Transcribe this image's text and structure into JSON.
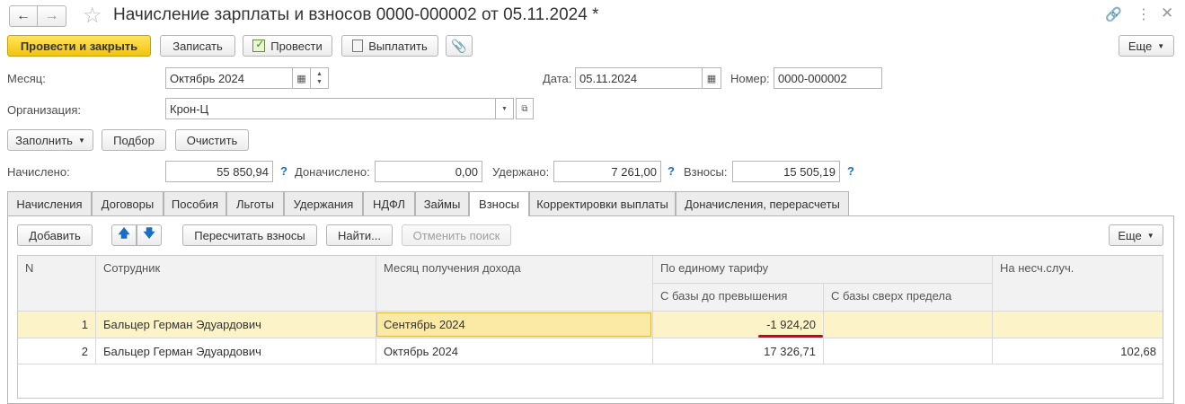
{
  "window": {
    "title": "Начисление зарплаты и взносов 0000-000002 от 05.11.2024 *"
  },
  "toolbar": {
    "post_and_close": "Провести и закрыть",
    "save": "Записать",
    "post": "Провести",
    "pay": "Выплатить",
    "more": "Еще"
  },
  "form": {
    "month_label": "Месяц:",
    "month_value": "Октябрь 2024",
    "date_label": "Дата:",
    "date_value": "05.11.2024",
    "number_label": "Номер:",
    "number_value": "0000-000002",
    "org_label": "Организация:",
    "org_value": "Крон-Ц",
    "fill_button": "Заполнить",
    "select_button": "Подбор",
    "clear_button": "Очистить",
    "accrued_label": "Начислено:",
    "accrued_value": "55 850,94",
    "extra_label": "Доначислено:",
    "extra_value": "0,00",
    "withheld_label": "Удержано:",
    "withheld_value": "7 261,00",
    "contrib_label": "Взносы:",
    "contrib_value": "15 505,19",
    "help": "?"
  },
  "tabs": [
    "Начисления",
    "Договоры",
    "Пособия",
    "Льготы",
    "Удержания",
    "НДФЛ",
    "Займы",
    "Взносы",
    "Корректировки выплаты",
    "Доначисления, перерасчеты"
  ],
  "tab_toolbar": {
    "add": "Добавить",
    "recalc": "Пересчитать взносы",
    "find": "Найти...",
    "cancel_search": "Отменить поиск",
    "more": "Еще"
  },
  "table": {
    "headers": {
      "n": "N",
      "employee": "Сотрудник",
      "income_month": "Месяц получения дохода",
      "single_tariff": "По единому тарифу",
      "base_below": "С базы до превышения",
      "base_above": "С базы сверх предела",
      "accident": "На несч.случ."
    },
    "rows": [
      {
        "n": "1",
        "employee": "Бальцер Герман Эдуардович",
        "month": "Сентябрь 2024",
        "base_below": "-1 924,20",
        "base_above": "",
        "accident": ""
      },
      {
        "n": "2",
        "employee": "Бальцер Герман Эдуардович",
        "month": "Октябрь 2024",
        "base_below": "17 326,71",
        "base_above": "",
        "accident": "102,68"
      }
    ]
  },
  "colors": {
    "primary_button": "#f2c40f",
    "selected_row": "#fdf3c9",
    "help_mark": "#1b6ec2",
    "underline": "#d0021b"
  }
}
